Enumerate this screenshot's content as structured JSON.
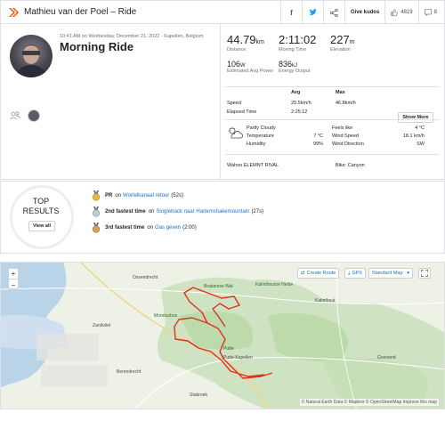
{
  "header": {
    "title": "Mathieu van der Poel – Ride",
    "kudos_label": "Give kudos",
    "kudos_count": "4819",
    "comment_count": "8"
  },
  "activity": {
    "datetime": "10:41 AM on Wednesday, December 21, 2022 · Kapellen, Belgium",
    "name": "Morning Ride"
  },
  "stats": {
    "distance_value": "44.79",
    "distance_unit": "km",
    "distance_label": "Distance",
    "moving_time_value": "2:11:02",
    "moving_time_label": "Moving Time",
    "elevation_value": "227",
    "elevation_unit": "m",
    "elevation_label": "Elevation",
    "power_value": "106",
    "power_unit": "W",
    "power_label": "Estimated Avg Power",
    "energy_value": "836",
    "energy_unit": "kJ",
    "energy_label": "Energy Output"
  },
  "table": {
    "avg_header": "Avg",
    "max_header": "Max",
    "show_more": "Show More",
    "speed_label": "Speed",
    "speed_avg": "20.5km/h",
    "speed_max": "46.8km/h",
    "elapsed_label": "Elapsed Time",
    "elapsed_value": "2:25:12"
  },
  "weather": {
    "condition": "Partly Cloudy",
    "temp_label": "Temperature",
    "temp_value": "7 °C",
    "humidity_label": "Humidity",
    "humidity_value": "99%",
    "feels_label": "Feels like",
    "feels_value": "4 °C",
    "wind_speed_label": "Wind Speed",
    "wind_speed_value": "18.1 km/h",
    "wind_dir_label": "Wind Direction",
    "wind_dir_value": "SW"
  },
  "device": "Wahoo ELEMNT RIVAL",
  "bike": "Bike: Canyon",
  "results": {
    "title_line1": "TOP",
    "title_line2": "RESULTS",
    "view_all": "View all",
    "items": [
      {
        "rank": "PR",
        "mid": "on",
        "segment": "Wortelkanaal retour",
        "time": "(52s)",
        "medal_color": "#e8b84a"
      },
      {
        "rank": "2nd fastest time",
        "mid": "on",
        "segment": "Singletrack naar Harlemshakemountain",
        "time": "(27s)",
        "medal_color": "#b8bcc4"
      },
      {
        "rank": "3rd fastest time",
        "mid": "on",
        "segment": "Gas geven",
        "time": "(2:00)",
        "medal_color": "#c98a3e"
      }
    ]
  },
  "map": {
    "zoom_in": "+",
    "zoom_out": "−",
    "create_route": "Create Route",
    "gpx": "GPX",
    "standard_map": "Standard Map",
    "attribution": "© Natural Earth Data © Mapbox © OpenStreetMap Improve this map",
    "places": {
      "ossendrecht": "Ossendrecht",
      "brabantse_wal": "Brabantse Wal",
      "kalmthoutse_heide": "Kalmthoutse Heide",
      "kalmthout": "Kalmthout",
      "zandvliet": "Zandvliet",
      "moretusbos": "Moretusbos",
      "putte": "Putte",
      "putte_kapellen": "Putte-Kapellen",
      "berendrecht": "Berendrecht",
      "stabroek": "Stabroek",
      "essen_heide": "Kalmthoutse Heide",
      "gooreind": "Gooreind"
    },
    "route_color": "#e03020"
  }
}
